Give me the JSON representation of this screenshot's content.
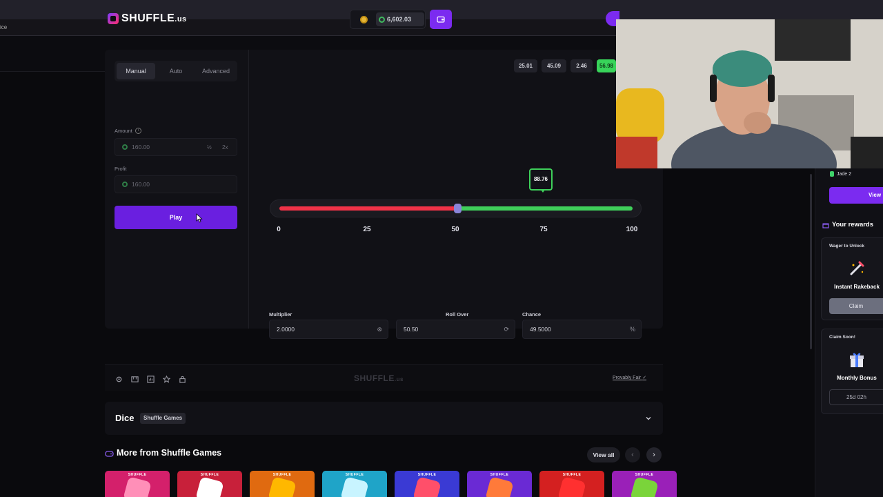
{
  "browser": {
    "url_fragment": "ice"
  },
  "header": {
    "logo_text": "SHUFFLE",
    "logo_suffix": ".us",
    "balance": "6,602.03",
    "wallet_icon": "wallet-icon"
  },
  "betting": {
    "tabs": [
      "Manual",
      "Auto",
      "Advanced"
    ],
    "active_tab": "Manual",
    "amount_label": "Amount",
    "amount_value": "160.00",
    "half_label": "½",
    "double_label": "2x",
    "profit_label": "Profit",
    "profit_value": "160.00",
    "play_label": "Play"
  },
  "history": [
    {
      "value": "25.01",
      "win": false
    },
    {
      "value": "45.09",
      "win": false
    },
    {
      "value": "2.46",
      "win": false
    },
    {
      "value": "56.98",
      "win": true
    }
  ],
  "dice": {
    "result": "88.76",
    "roll_over": 50.5,
    "ticks": [
      "0",
      "25",
      "50",
      "75",
      "100"
    ],
    "multiplier_label": "Multiplier",
    "multiplier_value": "2.0000",
    "rollover_label": "Roll Over",
    "rollover_value": "50.50",
    "chance_label": "Chance",
    "chance_value": "49.5000",
    "chance_suffix": "%"
  },
  "footer": {
    "watermark": "SHUFFLE",
    "watermark_suffix": ".us",
    "provably_fair": "Provably Fair",
    "icons": [
      "settings-icon",
      "ruler-icon",
      "stats-icon",
      "star-icon",
      "lock-icon"
    ]
  },
  "game_info": {
    "title": "Dice",
    "badge": "Shuffle Games"
  },
  "more_games": {
    "title": "More from Shuffle Games",
    "view_all": "View all",
    "prev": "‹",
    "next": "›",
    "card_brand": "SHUFFLE",
    "cards": [
      {
        "color": "#d4206b",
        "accent": "#ff8fb8"
      },
      {
        "color": "#c8203a",
        "accent": "#ffffff"
      },
      {
        "color": "#e06a10",
        "accent": "#ffb800"
      },
      {
        "color": "#1fa4c8",
        "accent": "#c8f4ff"
      },
      {
        "color": "#3a3ad4",
        "accent": "#ff4f6a"
      },
      {
        "color": "#6a2ad4",
        "accent": "#ff7a3a"
      },
      {
        "color": "#d42020",
        "accent": "#ff3030"
      },
      {
        "color": "#9a20b8",
        "accent": "#7ad43a"
      }
    ]
  },
  "sidebar": {
    "vip_level": "Jade 2",
    "view_label": "View",
    "rewards_title": "Your rewards",
    "rewards": [
      {
        "status": "Wager to Unlock",
        "name": "Instant Rakeback",
        "action": "Claim"
      },
      {
        "status": "Claim Soon!",
        "name": "Monthly Bonus",
        "action": "25d 02h"
      }
    ]
  }
}
